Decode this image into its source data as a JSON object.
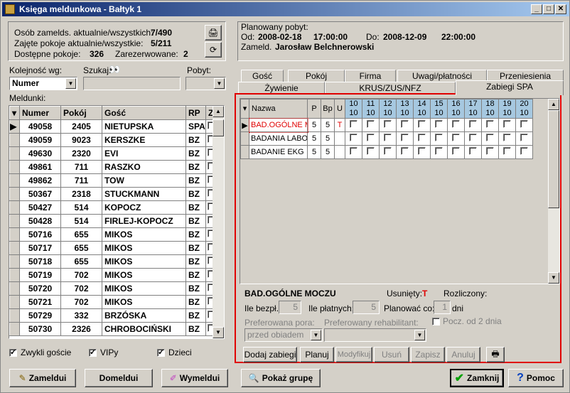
{
  "window": {
    "title": "Księga meldunkowa - Bałtyk 1"
  },
  "stats": {
    "guests_label": "Osób zamelds. aktualnie/wszystkich:",
    "guests_value": "7/490",
    "rooms_label": "Zajęte pokoje aktualnie/wszystkie:",
    "rooms_value": "5/211",
    "available_label": "Dostępne pokoje:",
    "available_value": "326",
    "reserved_label": "Zarezerwowane:",
    "reserved_value": "2"
  },
  "filters": {
    "order_label": "Kolejność wg:",
    "order_value": "Numer",
    "search_label": "Szukaj:",
    "stay_label": "Pobyt:",
    "list_label": "Meldunki:"
  },
  "table": {
    "headers": [
      "Numer",
      "Pokój",
      "Gość",
      "RP",
      "Z"
    ],
    "rows": [
      {
        "num": "49058",
        "room": "2405",
        "guest": "NIETUPSKA",
        "rp": "SPA"
      },
      {
        "num": "49059",
        "room": "9023",
        "guest": "KERSZKE",
        "rp": "BZ"
      },
      {
        "num": "49630",
        "room": "2320",
        "guest": "EVI",
        "rp": "BZ"
      },
      {
        "num": "49861",
        "room": "711",
        "guest": "RASZKO",
        "rp": "BZ"
      },
      {
        "num": "49862",
        "room": "711",
        "guest": "TOW",
        "rp": "BZ"
      },
      {
        "num": "50367",
        "room": "2318",
        "guest": "STUCKMANN",
        "rp": "BZ"
      },
      {
        "num": "50427",
        "room": "514",
        "guest": "KOPOCZ",
        "rp": "BZ"
      },
      {
        "num": "50428",
        "room": "514",
        "guest": "FIRLEJ-KOPOCZ",
        "rp": "BZ"
      },
      {
        "num": "50716",
        "room": "655",
        "guest": "MIKOS",
        "rp": "BZ"
      },
      {
        "num": "50717",
        "room": "655",
        "guest": "MIKOS",
        "rp": "BZ"
      },
      {
        "num": "50718",
        "room": "655",
        "guest": "MIKOS",
        "rp": "BZ"
      },
      {
        "num": "50719",
        "room": "702",
        "guest": "MIKOS",
        "rp": "BZ"
      },
      {
        "num": "50720",
        "room": "702",
        "guest": "MIKOS",
        "rp": "BZ"
      },
      {
        "num": "50721",
        "room": "702",
        "guest": "MIKOS",
        "rp": "BZ"
      },
      {
        "num": "50729",
        "room": "332",
        "guest": "BRZÓSKA",
        "rp": "BZ"
      },
      {
        "num": "50730",
        "room": "2326",
        "guest": "CHROBOCIŃSKI",
        "rp": "BZ"
      }
    ]
  },
  "checkboxes": {
    "regular": "Zwykli goście",
    "vip": "VIPy",
    "children": "Dzieci"
  },
  "stay": {
    "title": "Planowany pobyt:",
    "from_label": "Od:",
    "from_date": "2008-02-18",
    "from_time": "17:00:00",
    "to_label": "Do:",
    "to_date": "2008-12-09",
    "to_time": "22:00:00",
    "registered_label": "Zameld.",
    "registered_name": "Jarosław Belchnerowski"
  },
  "tabs_row1": [
    "Gość",
    "Pokój",
    "Firma",
    "Uwagi/płatności",
    "Przeniesienia"
  ],
  "tabs_row2": [
    "Żywienie",
    "KRUS/ZUS/NFZ",
    "Zabiegi SPA"
  ],
  "spa": {
    "headers": [
      "Nazwa",
      "P",
      "Bp",
      "U"
    ],
    "days": [
      {
        "d": "10",
        "m": "10"
      },
      {
        "d": "11",
        "m": "10"
      },
      {
        "d": "12",
        "m": "10"
      },
      {
        "d": "13",
        "m": "10"
      },
      {
        "d": "14",
        "m": "10"
      },
      {
        "d": "15",
        "m": "10"
      },
      {
        "d": "16",
        "m": "10"
      },
      {
        "d": "17",
        "m": "10"
      },
      {
        "d": "18",
        "m": "10"
      },
      {
        "d": "19",
        "m": "10"
      },
      {
        "d": "20",
        "m": "10"
      }
    ],
    "rows": [
      {
        "name": "BAD.OGÓLNE M",
        "p": "5",
        "bp": "5",
        "u": "T"
      },
      {
        "name": "BADANIA LABO",
        "p": "5",
        "bp": "5",
        "u": ""
      },
      {
        "name": "BADANIE EKG",
        "p": "5",
        "bp": "5",
        "u": ""
      }
    ],
    "detail": {
      "title": "BAD.OGÓLNE MOCZU",
      "removed_label": "Usunięty:",
      "removed_value": "T",
      "settled_label": "Rozliczony:",
      "unpaid_label": "Ile bezpł.:",
      "unpaid_value": "5",
      "paid_label": "Ile płatnych:",
      "paid_value": "5",
      "plan_every_label": "Planować co:",
      "plan_every_value": "1",
      "days_label": "dni",
      "start_label": "Pocz. od 2 dnia",
      "pref_time_label": "Preferowana pora:",
      "pref_time_value": "przed obiadem",
      "pref_rehab_label": "Preferowany rehabilitant:"
    },
    "buttons": [
      "Dodaj zabiegi",
      "Planuj",
      "Modyfikuj",
      "Usuń",
      "Zapisz",
      "Anuluj"
    ]
  },
  "footer": {
    "register": "Zameldui",
    "add": "Domeldui",
    "checkout": "Wymeldui",
    "group": "Pokaż grupę",
    "close": "Zamknij",
    "help": "Pomoc"
  }
}
